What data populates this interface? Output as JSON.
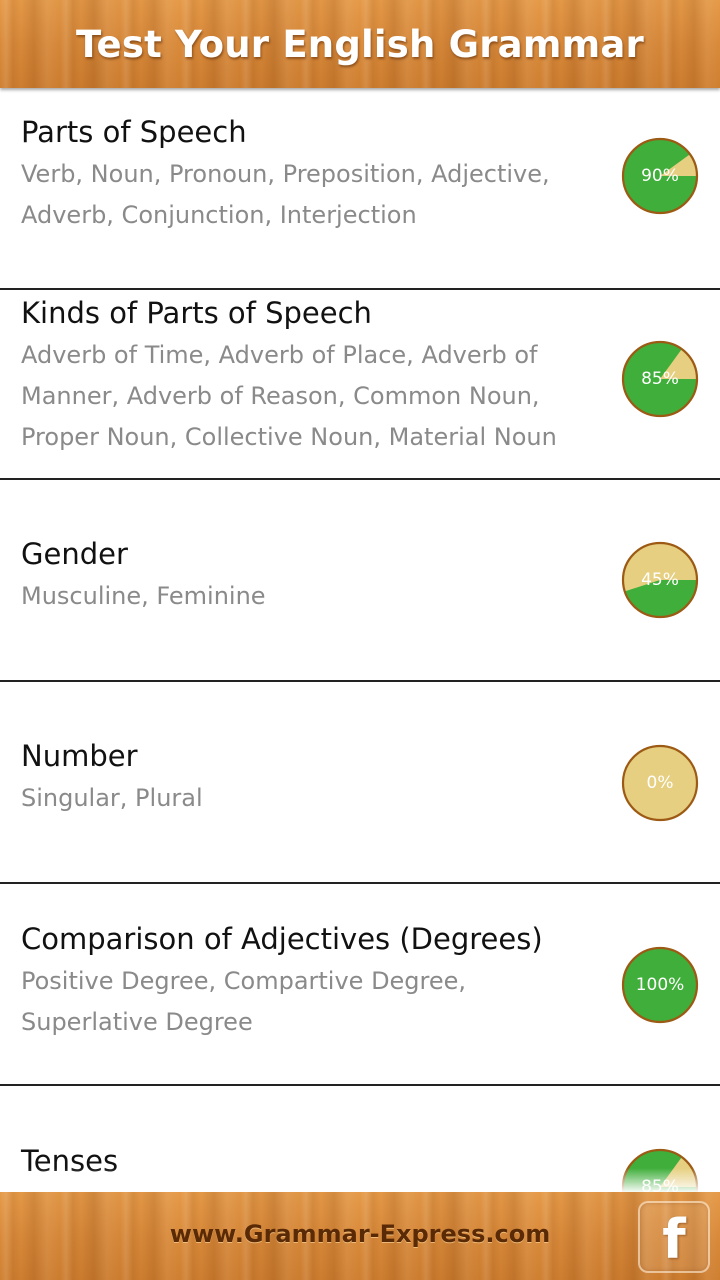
{
  "app": {
    "title": "Test Your English Grammar"
  },
  "colors": {
    "wood": "#d98a3a",
    "pie_done": "#3fae3a",
    "pie_remaining": "#e6cf80",
    "pie_border": "#9c5a14",
    "title_text": "#111111",
    "subtitle_text": "#8a8a8a"
  },
  "topics": [
    {
      "title": "Parts of Speech",
      "subtitle": "Verb, Noun, Pronoun, Preposition, Adjective, Adverb, Conjunction, Interjection",
      "percent": 90,
      "percent_label": "90%"
    },
    {
      "title": "Kinds of Parts of Speech",
      "subtitle": "Adverb of Time, Adverb of Place, Adverb of Manner, Adverb of Reason, Common Noun, Proper Noun, Collective Noun, Material Noun",
      "percent": 85,
      "percent_label": "85%"
    },
    {
      "title": "Gender",
      "subtitle": "Musculine, Feminine",
      "percent": 45,
      "percent_label": "45%"
    },
    {
      "title": "Number",
      "subtitle": "Singular, Plural",
      "percent": 0,
      "percent_label": "0%"
    },
    {
      "title": "Comparison of Adjectives (Degrees)",
      "subtitle": "Positive Degree, Compartive Degree, Superlative Degree",
      "percent": 100,
      "percent_label": "100%"
    },
    {
      "title": "Tenses",
      "subtitle": "",
      "percent": 85,
      "percent_label": "85%"
    }
  ],
  "footer": {
    "link_text": "www.Grammar-Express.com",
    "facebook_icon": "facebook-icon",
    "facebook_glyph": "f"
  }
}
